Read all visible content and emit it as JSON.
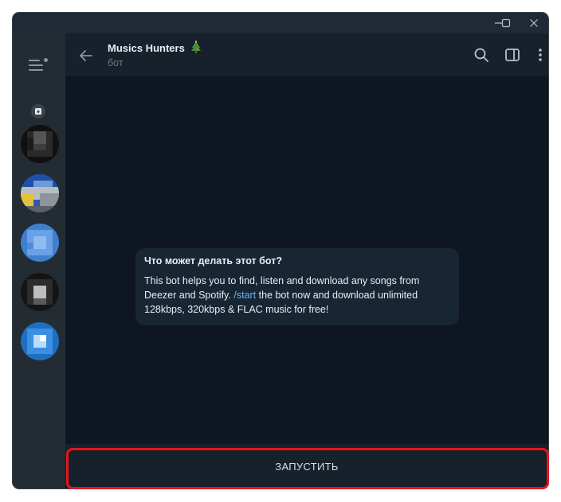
{
  "window": {
    "controls": {
      "minimize": "minimize-icon",
      "maximize": "maximize-icon",
      "close": "close-icon"
    }
  },
  "sidebar": {
    "menu_icon": "hamburger-menu-icon",
    "archive_icon": "archive-icon",
    "chats": [
      {
        "name": "chat-avatar-1"
      },
      {
        "name": "chat-avatar-2"
      },
      {
        "name": "chat-avatar-3"
      },
      {
        "name": "chat-avatar-4"
      },
      {
        "name": "chat-avatar-5"
      }
    ]
  },
  "header": {
    "title": "Musics Hunters",
    "title_emoji": "christmas-tree-icon",
    "subtitle": "бот",
    "icons": [
      "search-icon",
      "sidebar-toggle-icon",
      "more-vertical-icon"
    ]
  },
  "message": {
    "title": "Что может делать этот бот?",
    "text_part1": "This bot helps you to find, listen and download any songs from Deezer and Spotify. ",
    "command": "/start",
    "text_part2": " the bot now and download unlimited 128kbps, 320kbps & FLAC music for free!"
  },
  "footer": {
    "start_label": "ЗАПУСТИТЬ"
  },
  "colors": {
    "background": "#0e1621",
    "panel": "#17212b",
    "bubble": "#182533",
    "link": "#6ab3f3",
    "highlight": "#e8141c"
  }
}
